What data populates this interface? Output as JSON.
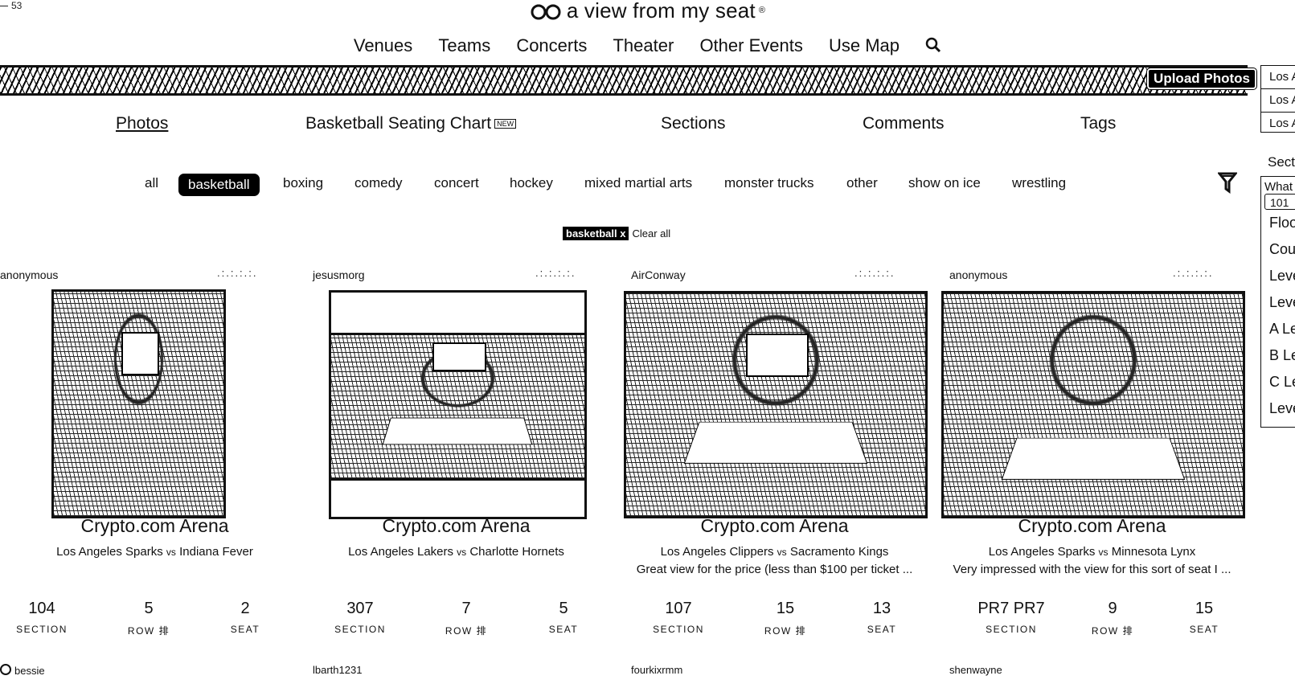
{
  "corner_text": "53",
  "site": {
    "name": "a view from my seat",
    "reg": "®"
  },
  "nav": [
    "Venues",
    "Teams",
    "Concerts",
    "Theater",
    "Other Events",
    "Use Map"
  ],
  "upload_label": "Upload Photos",
  "sidebar": {
    "links": [
      "Los A",
      "Los A",
      "Los A"
    ],
    "section_title": "Secti",
    "question": "What",
    "input_value": "101",
    "options": [
      "Floo",
      "Cou",
      "Leve",
      "Leve",
      "A Le",
      "B Le",
      "C Le",
      "Leve"
    ]
  },
  "tabs": [
    "Photos",
    "Basketball Seating Chart",
    "Sections",
    "Comments",
    "Tags"
  ],
  "new_badge": "NEW",
  "filters": [
    "all",
    "basketball",
    "boxing",
    "comedy",
    "concert",
    "hockey",
    "mixed martial arts",
    "monster trucks",
    "other",
    "show on ice",
    "wrestling"
  ],
  "applied": {
    "tag": "basketball",
    "remove": "x",
    "clear": "Clear all"
  },
  "stars_text": ".:.:.:.:.",
  "cards": [
    {
      "user": "anonymous",
      "venue": "Crypto.com Arena",
      "home": "Los Angeles Sparks",
      "vs": "vs",
      "away": "Indiana Fever",
      "comment": "",
      "section": "104",
      "row": "5",
      "seat": "2"
    },
    {
      "user": "jesusmorg",
      "venue": "Crypto.com Arena",
      "home": "Los Angeles Lakers",
      "vs": "vs",
      "away": "Charlotte Hornets",
      "comment": "",
      "section": "307",
      "row": "7",
      "seat": "5"
    },
    {
      "user": "AirConway",
      "venue": "Crypto.com Arena",
      "home": "Los Angeles Clippers",
      "vs": "vs",
      "away": "Sacramento Kings",
      "comment": "Great view for the price (less than $100 per ticket ...",
      "section": "107",
      "row": "15",
      "seat": "13"
    },
    {
      "user": "anonymous",
      "venue": "Crypto.com Arena",
      "home": "Los Angeles Sparks",
      "vs": "vs",
      "away": "Minnesota Lynx",
      "comment": "Very impressed with the view for this sort of seat I ...",
      "section": "PR7 PR7",
      "row": "9",
      "seat": "15"
    }
  ],
  "labels": {
    "section": "SECTION",
    "row": "ROW 排",
    "seat": "SEAT"
  },
  "next_users": [
    "bessie",
    "lbarth1231",
    "fourkixrmm",
    "shenwayne"
  ]
}
